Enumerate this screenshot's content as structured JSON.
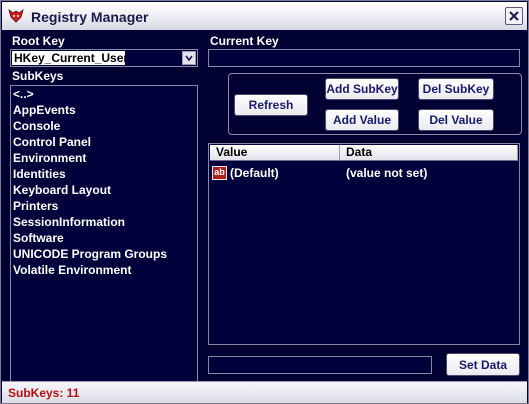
{
  "window": {
    "title": "Registry Manager"
  },
  "root_key": {
    "label": "Root Key",
    "value": "HKey_Current_User"
  },
  "current_key": {
    "label": "Current Key",
    "value": ""
  },
  "subkeys": {
    "label": "SubKeys",
    "items": [
      "<..>",
      "AppEvents",
      "Console",
      "Control Panel",
      "Environment",
      "Identities",
      "Keyboard Layout",
      "Printers",
      "SessionInformation",
      "Software",
      "UNICODE Program Groups",
      "Volatile Environment"
    ]
  },
  "buttons": {
    "refresh": "Refresh",
    "add_subkey": "Add SubKey",
    "del_subkey": "Del SubKey",
    "add_value": "Add Value",
    "del_value": "Del Value",
    "set_data": "Set Data"
  },
  "values_table": {
    "columns": [
      "Value",
      "Data"
    ],
    "rows": [
      {
        "icon": "string-value-icon",
        "icon_text": "ab",
        "value": "(Default)",
        "data": "(value not set)"
      }
    ]
  },
  "data_field": {
    "value": ""
  },
  "status": {
    "text": "SubKeys: 11"
  },
  "colors": {
    "background": "#000033",
    "status_text": "#b01010"
  }
}
